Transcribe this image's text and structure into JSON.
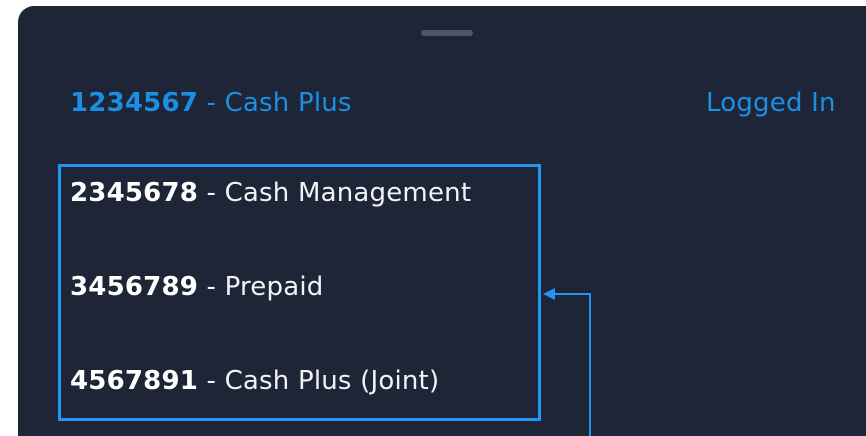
{
  "current_account": {
    "number": "1234567",
    "separator": " - ",
    "name": "Cash Plus"
  },
  "status": "Logged In",
  "other_accounts": [
    {
      "number": "2345678",
      "separator": " - ",
      "name": "Cash Management"
    },
    {
      "number": "3456789",
      "separator": " - ",
      "name": "Prepaid"
    },
    {
      "number": "4567891",
      "separator": " - ",
      "name": "Cash Plus (Joint)"
    }
  ],
  "colors": {
    "sheet_background": "#1e2537",
    "accent": "#1b8fe3",
    "highlight": "#2196f3",
    "text": "#ffffff"
  },
  "icons": {
    "grabber": "drag-handle-icon",
    "annotation": "callout-arrow-icon"
  }
}
